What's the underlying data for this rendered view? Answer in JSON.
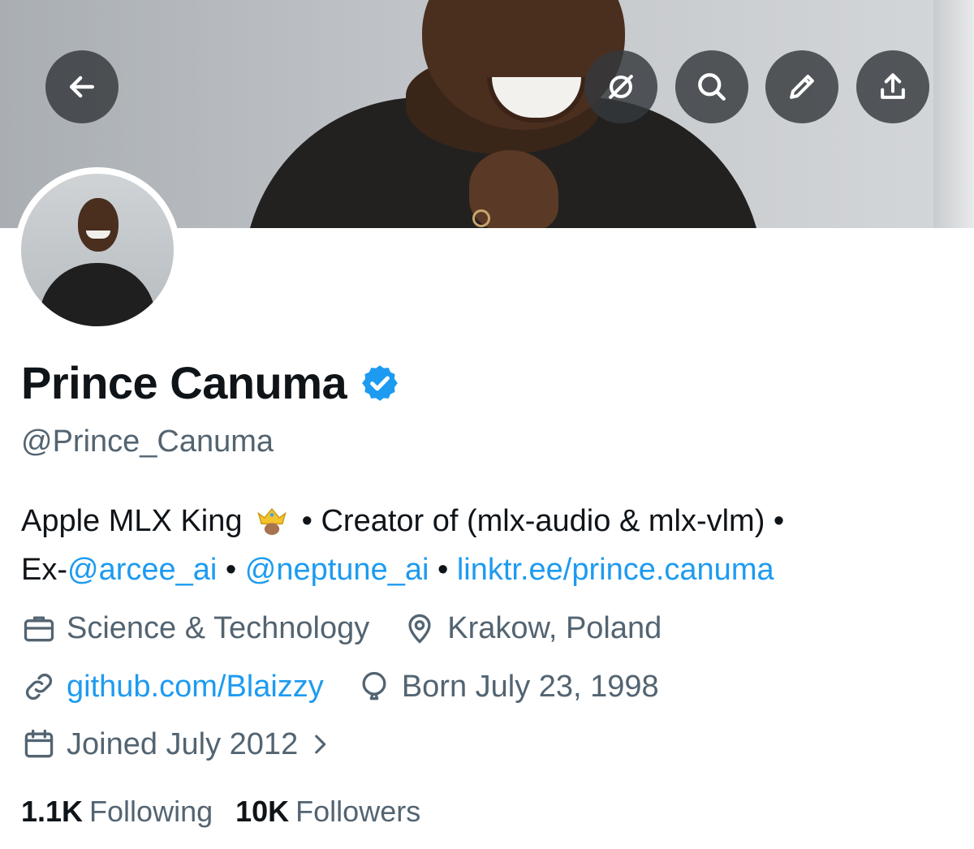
{
  "banner": {
    "buttons": {
      "back": "back",
      "grok": "grok",
      "search": "search",
      "edit": "edit",
      "share": "share"
    }
  },
  "profile": {
    "name": "Prince Canuma",
    "handle": "@Prince_Canuma",
    "bio": {
      "part1": "Apple MLX King",
      "emoji": "crown",
      "part2": " • Creator of (mlx-audio & mlx-vlm) •",
      "ex_prefix": "Ex-",
      "mention1": "@arcee_ai",
      "sep1": " • ",
      "mention2": "@neptune_ai",
      "sep2": " • ",
      "link": "linktr.ee/prince.canuma"
    },
    "category": "Science & Technology",
    "location": "Krakow, Poland",
    "website": "github.com/Blaizzy",
    "born": "Born July 23, 1998",
    "joined": "Joined July 2012",
    "following_count": "1.1K",
    "following_label": "Following",
    "followers_count": "10K",
    "followers_label": "Followers"
  },
  "colors": {
    "link": "#1d9bf0",
    "secondary_text": "#536471",
    "primary_text": "#0f1419"
  }
}
